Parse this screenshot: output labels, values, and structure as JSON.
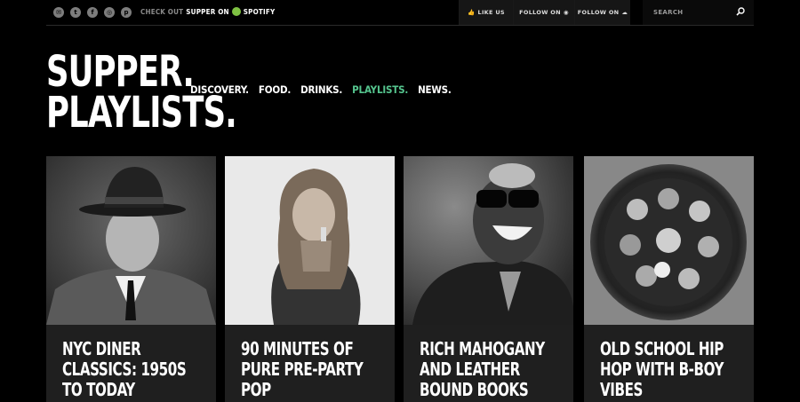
{
  "topbar": {
    "social_icons": [
      "mail-icon",
      "twitter-icon",
      "facebook-icon",
      "instagram-icon",
      "pinterest-icon"
    ],
    "checkout_prefix": "CHECK OUT",
    "checkout_brand": "SUPPER ON",
    "checkout_service": "SPOTIFY",
    "like_label": "LIKE US",
    "follow_spotify_label": "FOLLOW ON",
    "follow_soundcloud_label": "FOLLOW ON",
    "search_placeholder": "SEARCH"
  },
  "logo": {
    "line1": "SUPPER.",
    "line2": "PLAYLISTS."
  },
  "nav": [
    {
      "label": "DISCOVERY.",
      "active": false
    },
    {
      "label": "FOOD.",
      "active": false
    },
    {
      "label": "DRINKS.",
      "active": false
    },
    {
      "label": "PLAYLISTS.",
      "active": true
    },
    {
      "label": "NEWS.",
      "active": false
    }
  ],
  "colors": {
    "accent": "#55c58e",
    "background": "#000000",
    "card": "#1f1f1f",
    "spotify": "#7ec142"
  },
  "cards": [
    {
      "title": "NYC DINER CLASSICS: 1950S TO TODAY"
    },
    {
      "title": "90 MINUTES OF PURE PRE-PARTY POP"
    },
    {
      "title": "RICH MAHOGANY AND LEATHER BOUND BOOKS"
    },
    {
      "title": "OLD SCHOOL HIP HOP WITH B-BOY VIBES"
    }
  ]
}
